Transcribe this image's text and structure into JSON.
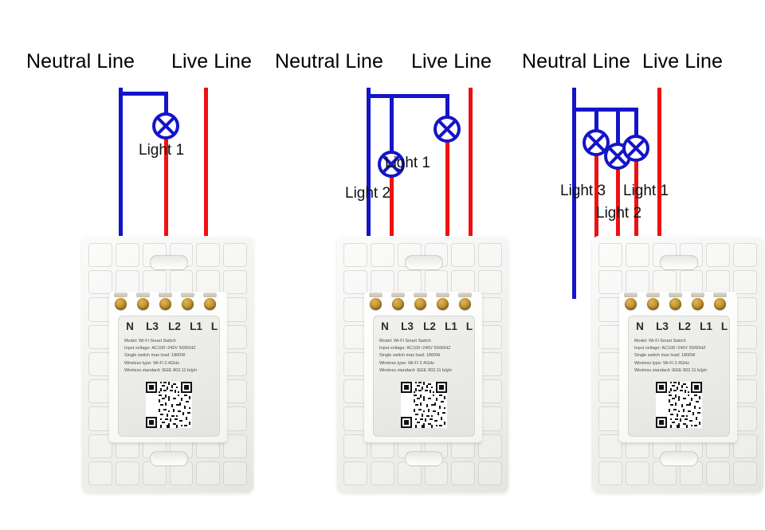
{
  "diagram": {
    "type": "wiring-diagram",
    "description": "Wi-Fi smart switch wiring diagrams for 1-gang, 2-gang and 3-gang configurations",
    "colors": {
      "neutral_wire": "#1414c8",
      "live_wire": "#ee1111",
      "lamp_symbol": "#1414c8",
      "text": "#000000",
      "plate": "#f3f3f1"
    }
  },
  "labels": {
    "neutral_line": "Neutral Line",
    "live_line": "Live Line",
    "light_1": "Light 1",
    "light_2": "Light 2",
    "light_3": "Light 3"
  },
  "device": {
    "terminals": [
      "N",
      "L3",
      "L2",
      "L1",
      "L"
    ],
    "spec": [
      "Model:   Wi-Fi Smart Switch",
      "Input voltage:   AC100~240V  50/60HZ",
      "Single switch max load:   1800W",
      "Wireless type:   Wi-Fi 2.4GHz",
      "Wireless standard:   IEEE 802.11 b/g/n"
    ],
    "qr_code": "qr-code"
  },
  "panels": [
    {
      "id": "panel-1",
      "name": "one-gang-wiring",
      "lights_count": 1,
      "neutral_title": "Neutral Line",
      "live_title": "Live Line",
      "lights": [
        {
          "label": "Light 1",
          "terminal": "L2"
        }
      ],
      "connected_terminals": [
        "N",
        "L2",
        "L"
      ]
    },
    {
      "id": "panel-2",
      "name": "two-gang-wiring",
      "lights_count": 2,
      "neutral_title": "Neutral Line",
      "live_title": "Live Line",
      "lights": [
        {
          "label": "Light 1",
          "terminal": "L1"
        },
        {
          "label": "Light 2",
          "terminal": "L3"
        }
      ],
      "connected_terminals": [
        "N",
        "L3",
        "L1",
        "L"
      ]
    },
    {
      "id": "panel-3",
      "name": "three-gang-wiring",
      "lights_count": 3,
      "neutral_title": "Neutral Line",
      "live_title": "Live Line",
      "lights": [
        {
          "label": "Light 3",
          "terminal": "L3"
        },
        {
          "label": "Light 2",
          "terminal": "L2"
        },
        {
          "label": "Light 1",
          "terminal": "L1"
        }
      ],
      "connected_terminals": [
        "N",
        "L3",
        "L2",
        "L1",
        "L"
      ]
    }
  ]
}
